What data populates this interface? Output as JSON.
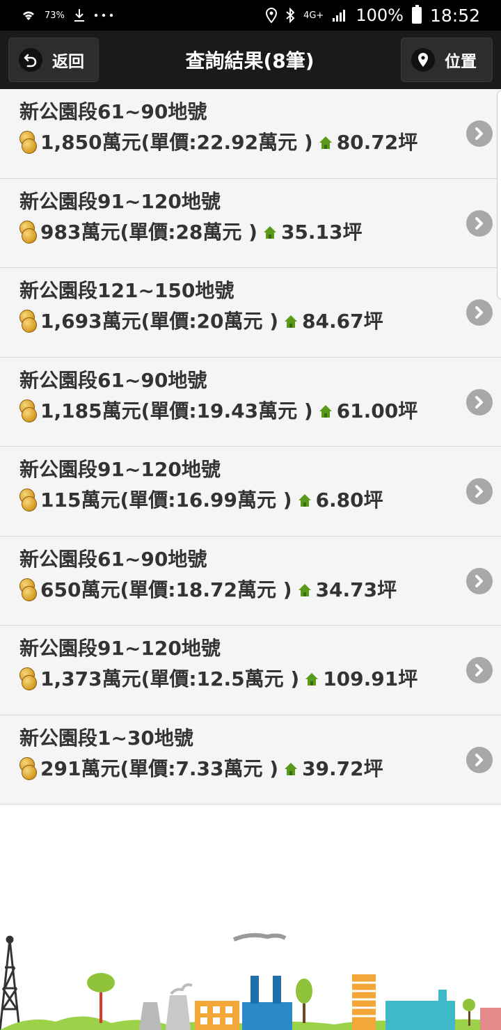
{
  "status_bar": {
    "battery_indicator": "73%",
    "network": "4G+",
    "battery": "100%",
    "time": "18:52"
  },
  "header": {
    "back_label": "返回",
    "title": "查詢結果(8筆)",
    "location_label": "位置"
  },
  "results": [
    {
      "title": "新公園段61~90地號",
      "price": "1,850萬元(單價:22.92萬元 )",
      "area": "80.72坪"
    },
    {
      "title": "新公園段91~120地號",
      "price": "983萬元(單價:28萬元 )",
      "area": "35.13坪"
    },
    {
      "title": "新公園段121~150地號",
      "price": "1,693萬元(單價:20萬元 )",
      "area": "84.67坪"
    },
    {
      "title": "新公園段61~90地號",
      "price": "1,185萬元(單價:19.43萬元 )",
      "area": "61.00坪"
    },
    {
      "title": "新公園段91~120地號",
      "price": "115萬元(單價:16.99萬元 )",
      "area": "6.80坪"
    },
    {
      "title": "新公園段61~90地號",
      "price": "650萬元(單價:18.72萬元 )",
      "area": "34.73坪"
    },
    {
      "title": "新公園段91~120地號",
      "price": "1,373萬元(單價:12.5萬元 )",
      "area": "109.91坪"
    },
    {
      "title": "新公園段1~30地號",
      "price": "291萬元(單價:7.33萬元 )",
      "area": "39.72坪"
    }
  ],
  "colors": {
    "header_bg": "#1a1a1a",
    "list_bg": "#f5f5f5",
    "chevron": "#a8a8a8",
    "home_icon": "#5a9a1a",
    "coin": "#d59a20"
  }
}
